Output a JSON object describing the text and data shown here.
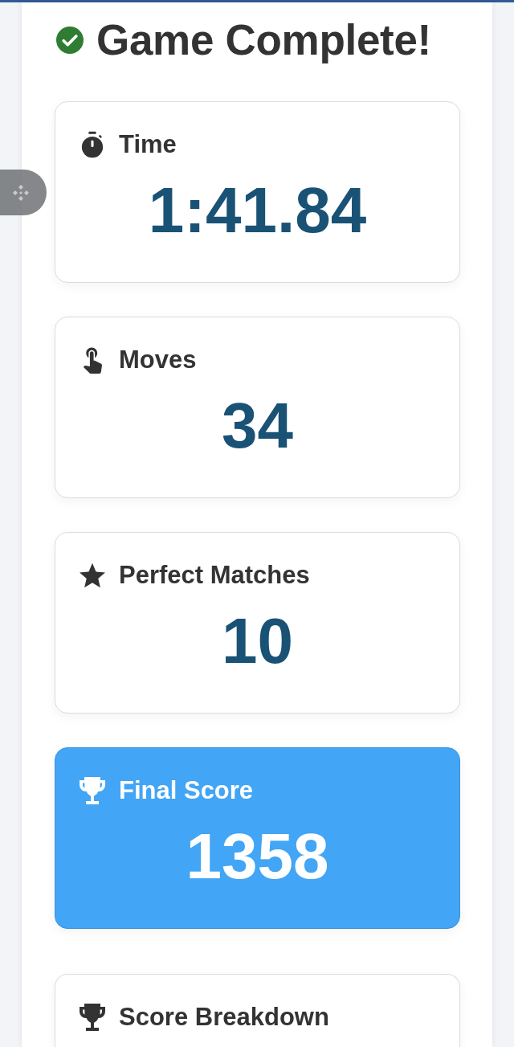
{
  "header": {
    "title": "Game Complete!"
  },
  "cards": [
    {
      "kind": "time",
      "label": "Time",
      "value": "1:41.84",
      "highlighted": false
    },
    {
      "kind": "moves",
      "label": "Moves",
      "value": "34",
      "highlighted": false
    },
    {
      "kind": "matches",
      "label": "Perfect Matches",
      "value": "10",
      "highlighted": false
    },
    {
      "kind": "score",
      "label": "Final Score",
      "value": "1358",
      "highlighted": true
    },
    {
      "kind": "breakdown",
      "label": "Score Breakdown",
      "highlighted": false
    }
  ]
}
